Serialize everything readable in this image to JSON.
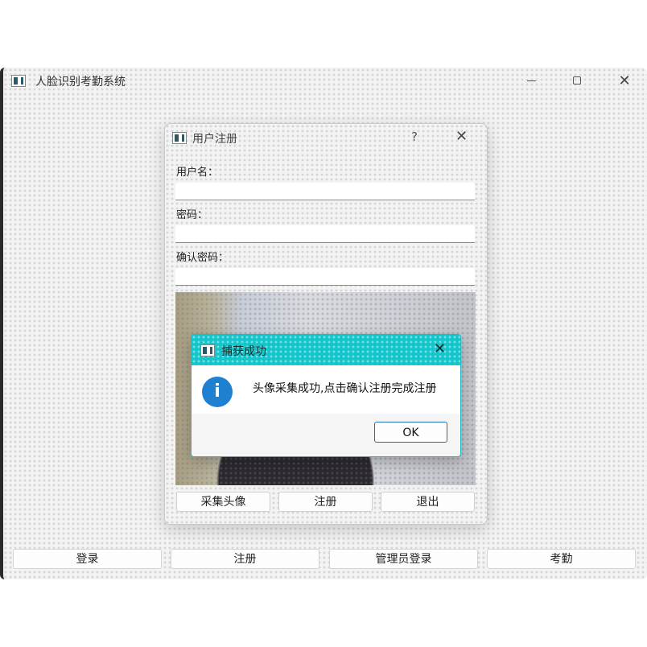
{
  "main_window": {
    "title": "人脸识别考勤系统",
    "close_symbol": "✕",
    "bottom_buttons": [
      "登录",
      "注册",
      "管理员登录",
      "考勤"
    ]
  },
  "register_dialog": {
    "title": "用户注册",
    "help_symbol": "?",
    "close_symbol": "✕",
    "username_label": "用户名：",
    "password_label": "密码：",
    "confirm_label": "确认密码：",
    "username_value": "",
    "password_value": "",
    "confirm_value": "",
    "buttons": [
      "采集头像",
      "注册",
      "退出"
    ]
  },
  "message_box": {
    "title": "捕获成功",
    "close_symbol": "✕",
    "icon_symbol": "i",
    "message": "头像采集成功,点击确认注册完成注册",
    "ok_label": "OK"
  },
  "colors": {
    "msg_titlebar": "#12c6cc",
    "info_icon": "#1f7fd0",
    "ok_border": "#1f6fb8"
  }
}
